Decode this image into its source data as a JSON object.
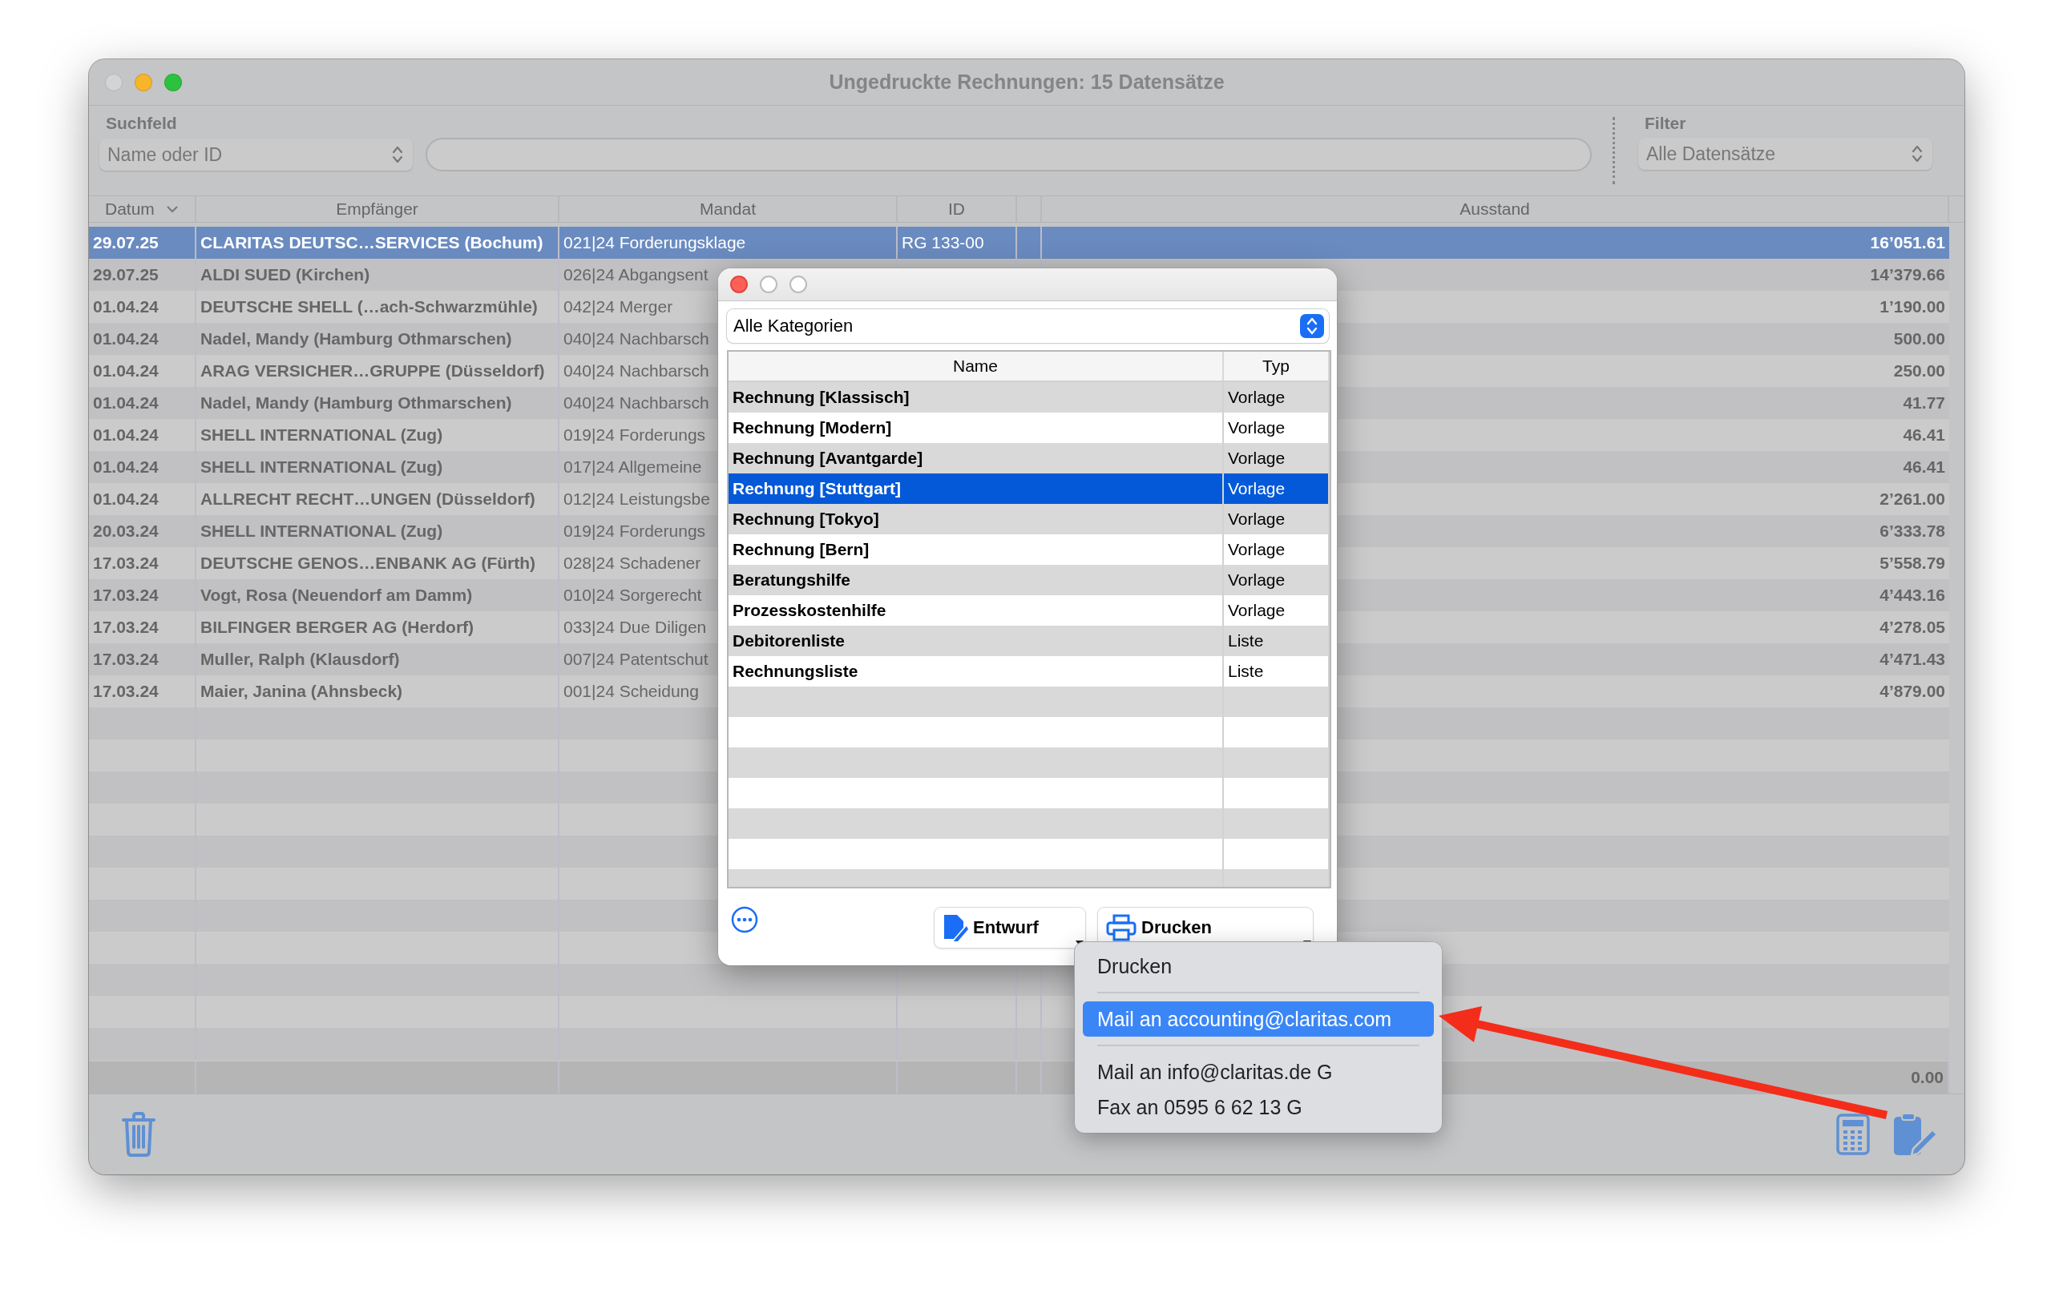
{
  "window": {
    "title": "Ungedruckte Rechnungen: 15 Datensätze"
  },
  "search": {
    "label": "Suchfeld",
    "mode": "Name oder ID"
  },
  "filter": {
    "label": "Filter",
    "value": "Alle Datensätze"
  },
  "table": {
    "columns": [
      {
        "label": "Datum",
        "sorted": true
      },
      {
        "label": "Empfänger",
        "sorted": false
      },
      {
        "label": "Mandat",
        "sorted": false
      },
      {
        "label": "ID",
        "sorted": false
      },
      {
        "label": "Ausstand",
        "sorted": false
      }
    ],
    "rows": [
      {
        "datum": "29.07.25",
        "empfaenger": "CLARITAS DEUTSC…SERVICES (Bochum)",
        "mandat": "021|24 Forderungsklage",
        "id": "RG 133-00",
        "ausstand": "16’051.61",
        "selected": true
      },
      {
        "datum": "29.07.25",
        "empfaenger": "ALDI SUED (Kirchen)",
        "mandat": "026|24 Abgangsent",
        "ausstand": "14’379.66",
        "selected": false
      },
      {
        "datum": "01.04.24",
        "empfaenger": "DEUTSCHE SHELL (…ach-Schwarzmühle)",
        "mandat": "042|24 Merger",
        "ausstand": "1’190.00",
        "selected": false
      },
      {
        "datum": "01.04.24",
        "empfaenger": "Nadel, Mandy (Hamburg Othmarschen)",
        "mandat": "040|24 Nachbarsch",
        "ausstand": "500.00",
        "selected": false
      },
      {
        "datum": "01.04.24",
        "empfaenger": "ARAG VERSICHER…GRUPPE (Düsseldorf)",
        "mandat": "040|24 Nachbarsch",
        "ausstand": "250.00",
        "selected": false
      },
      {
        "datum": "01.04.24",
        "empfaenger": "Nadel, Mandy (Hamburg Othmarschen)",
        "mandat": "040|24 Nachbarsch",
        "ausstand": "41.77",
        "selected": false
      },
      {
        "datum": "01.04.24",
        "empfaenger": "SHELL INTERNATIONAL (Zug)",
        "mandat": "019|24 Forderungs",
        "ausstand": "46.41",
        "selected": false
      },
      {
        "datum": "01.04.24",
        "empfaenger": "SHELL INTERNATIONAL (Zug)",
        "mandat": "017|24 Allgemeine",
        "ausstand": "46.41",
        "selected": false
      },
      {
        "datum": "01.04.24",
        "empfaenger": "ALLRECHT RECHT…UNGEN (Düsseldorf)",
        "mandat": "012|24 Leistungsbe",
        "ausstand": "2’261.00",
        "selected": false
      },
      {
        "datum": "20.03.24",
        "empfaenger": "SHELL INTERNATIONAL (Zug)",
        "mandat": "019|24 Forderungs",
        "ausstand": "6’333.78",
        "selected": false
      },
      {
        "datum": "17.03.24",
        "empfaenger": "DEUTSCHE GENOS…ENBANK AG (Fürth)",
        "mandat": "028|24 Schadener",
        "ausstand": "5’558.79",
        "selected": false
      },
      {
        "datum": "17.03.24",
        "empfaenger": "Vogt, Rosa (Neuendorf am Damm)",
        "mandat": "010|24 Sorgerecht",
        "ausstand": "4’443.16",
        "selected": false
      },
      {
        "datum": "17.03.24",
        "empfaenger": "BILFINGER BERGER AG (Herdorf)",
        "mandat": "033|24 Due Diligen",
        "ausstand": "4’278.05",
        "selected": false
      },
      {
        "datum": "17.03.24",
        "empfaenger": "Muller, Ralph (Klausdorf)",
        "mandat": "007|24 Patentschut",
        "ausstand": "4’471.43",
        "selected": false
      },
      {
        "datum": "17.03.24",
        "empfaenger": "Maier, Janina (Ahnsbeck)",
        "mandat": "001|24 Scheidung",
        "ausstand": "4’879.00",
        "selected": false
      }
    ],
    "total": "0.00"
  },
  "dialog": {
    "category": "Alle Kategorien",
    "columns": [
      "Name",
      "Typ"
    ],
    "rows": [
      {
        "name": "Rechnung [Klassisch]",
        "typ": "Vorlage",
        "selected": false
      },
      {
        "name": "Rechnung [Modern]",
        "typ": "Vorlage",
        "selected": false
      },
      {
        "name": "Rechnung [Avantgarde]",
        "typ": "Vorlage",
        "selected": false
      },
      {
        "name": "Rechnung [Stuttgart]",
        "typ": "Vorlage",
        "selected": true
      },
      {
        "name": "Rechnung [Tokyo]",
        "typ": "Vorlage",
        "selected": false
      },
      {
        "name": "Rechnung [Bern]",
        "typ": "Vorlage",
        "selected": false
      },
      {
        "name": "Beratungshilfe",
        "typ": "Vorlage",
        "selected": false
      },
      {
        "name": "Prozesskostenhilfe",
        "typ": "Vorlage",
        "selected": false
      },
      {
        "name": "Debitorenliste",
        "typ": "Liste",
        "selected": false
      },
      {
        "name": "Rechnungsliste",
        "typ": "Liste",
        "selected": false
      }
    ],
    "buttons": [
      {
        "label": "Entwurf",
        "kind": "draft"
      },
      {
        "label": "Drucken",
        "kind": "print"
      }
    ]
  },
  "menu": {
    "items": [
      {
        "kind": "item",
        "label": "Drucken",
        "selected": false
      },
      {
        "kind": "separator"
      },
      {
        "kind": "item",
        "label": "Mail an accounting@claritas.com",
        "selected": true
      },
      {
        "kind": "separator"
      },
      {
        "kind": "item",
        "label": "Mail an info@claritas.de G",
        "selected": false
      },
      {
        "kind": "item",
        "label": "Fax an 0595 6 62 13 G",
        "selected": false
      }
    ]
  }
}
